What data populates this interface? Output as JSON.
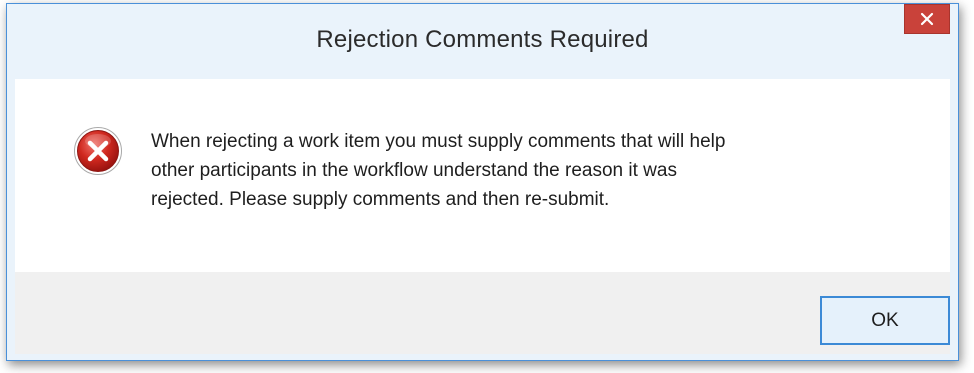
{
  "dialog": {
    "title": "Rejection Comments Required",
    "close_icon": "close-icon",
    "icon": "error-icon",
    "message": "When rejecting a work item you must supply comments that will help\nother participants in the workflow understand the reason it was\nrejected.  Please supply comments and then re-submit.",
    "ok_label": "OK"
  },
  "colors": {
    "title_bar": "#eaf3fb",
    "close_button": "#c9423a",
    "error_icon": "#c0211c",
    "ok_border": "#3c8ad6"
  }
}
